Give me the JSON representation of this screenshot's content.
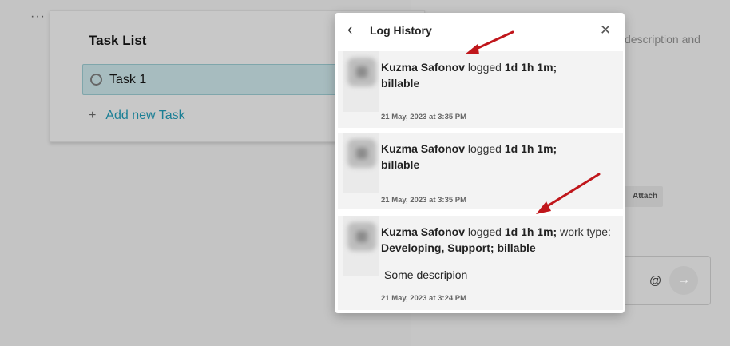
{
  "background": {
    "menu_dots": "···",
    "description_fragment": "description and",
    "attach_label": "Attach",
    "mention_symbol": "@",
    "send_symbol": "→"
  },
  "task_panel": {
    "title": "Task List",
    "tasks": [
      {
        "name": "Task 1"
      }
    ],
    "add_task_label": "Add new Task",
    "add_symbol": "+"
  },
  "modal": {
    "title": "Log History",
    "back_symbol": "‹",
    "close_symbol": "✕",
    "entries": [
      {
        "user": "Kuzma Safonov",
        "verb": "logged",
        "duration": "1d 1h 1m;",
        "details": "billable",
        "note": "",
        "date": "21 May, 2023 at 3:35 PM"
      },
      {
        "user": "Kuzma Safonov",
        "verb": "logged",
        "duration": "1d 1h 1m;",
        "details": "billable",
        "note": "",
        "date": "21 May, 2023 at 3:35 PM"
      },
      {
        "user": "Kuzma Safonov",
        "verb": "logged",
        "duration": "1d 1h 1m;",
        "worktype_label": "work type:",
        "details": "Developing, Support; billable",
        "note": "Some descripion",
        "date": "21 May, 2023 at 3:24 PM"
      }
    ]
  },
  "colors": {
    "overlay": "#c4c4c4",
    "accent_link": "#1b7f95",
    "annotation_arrow": "#c0161b"
  }
}
